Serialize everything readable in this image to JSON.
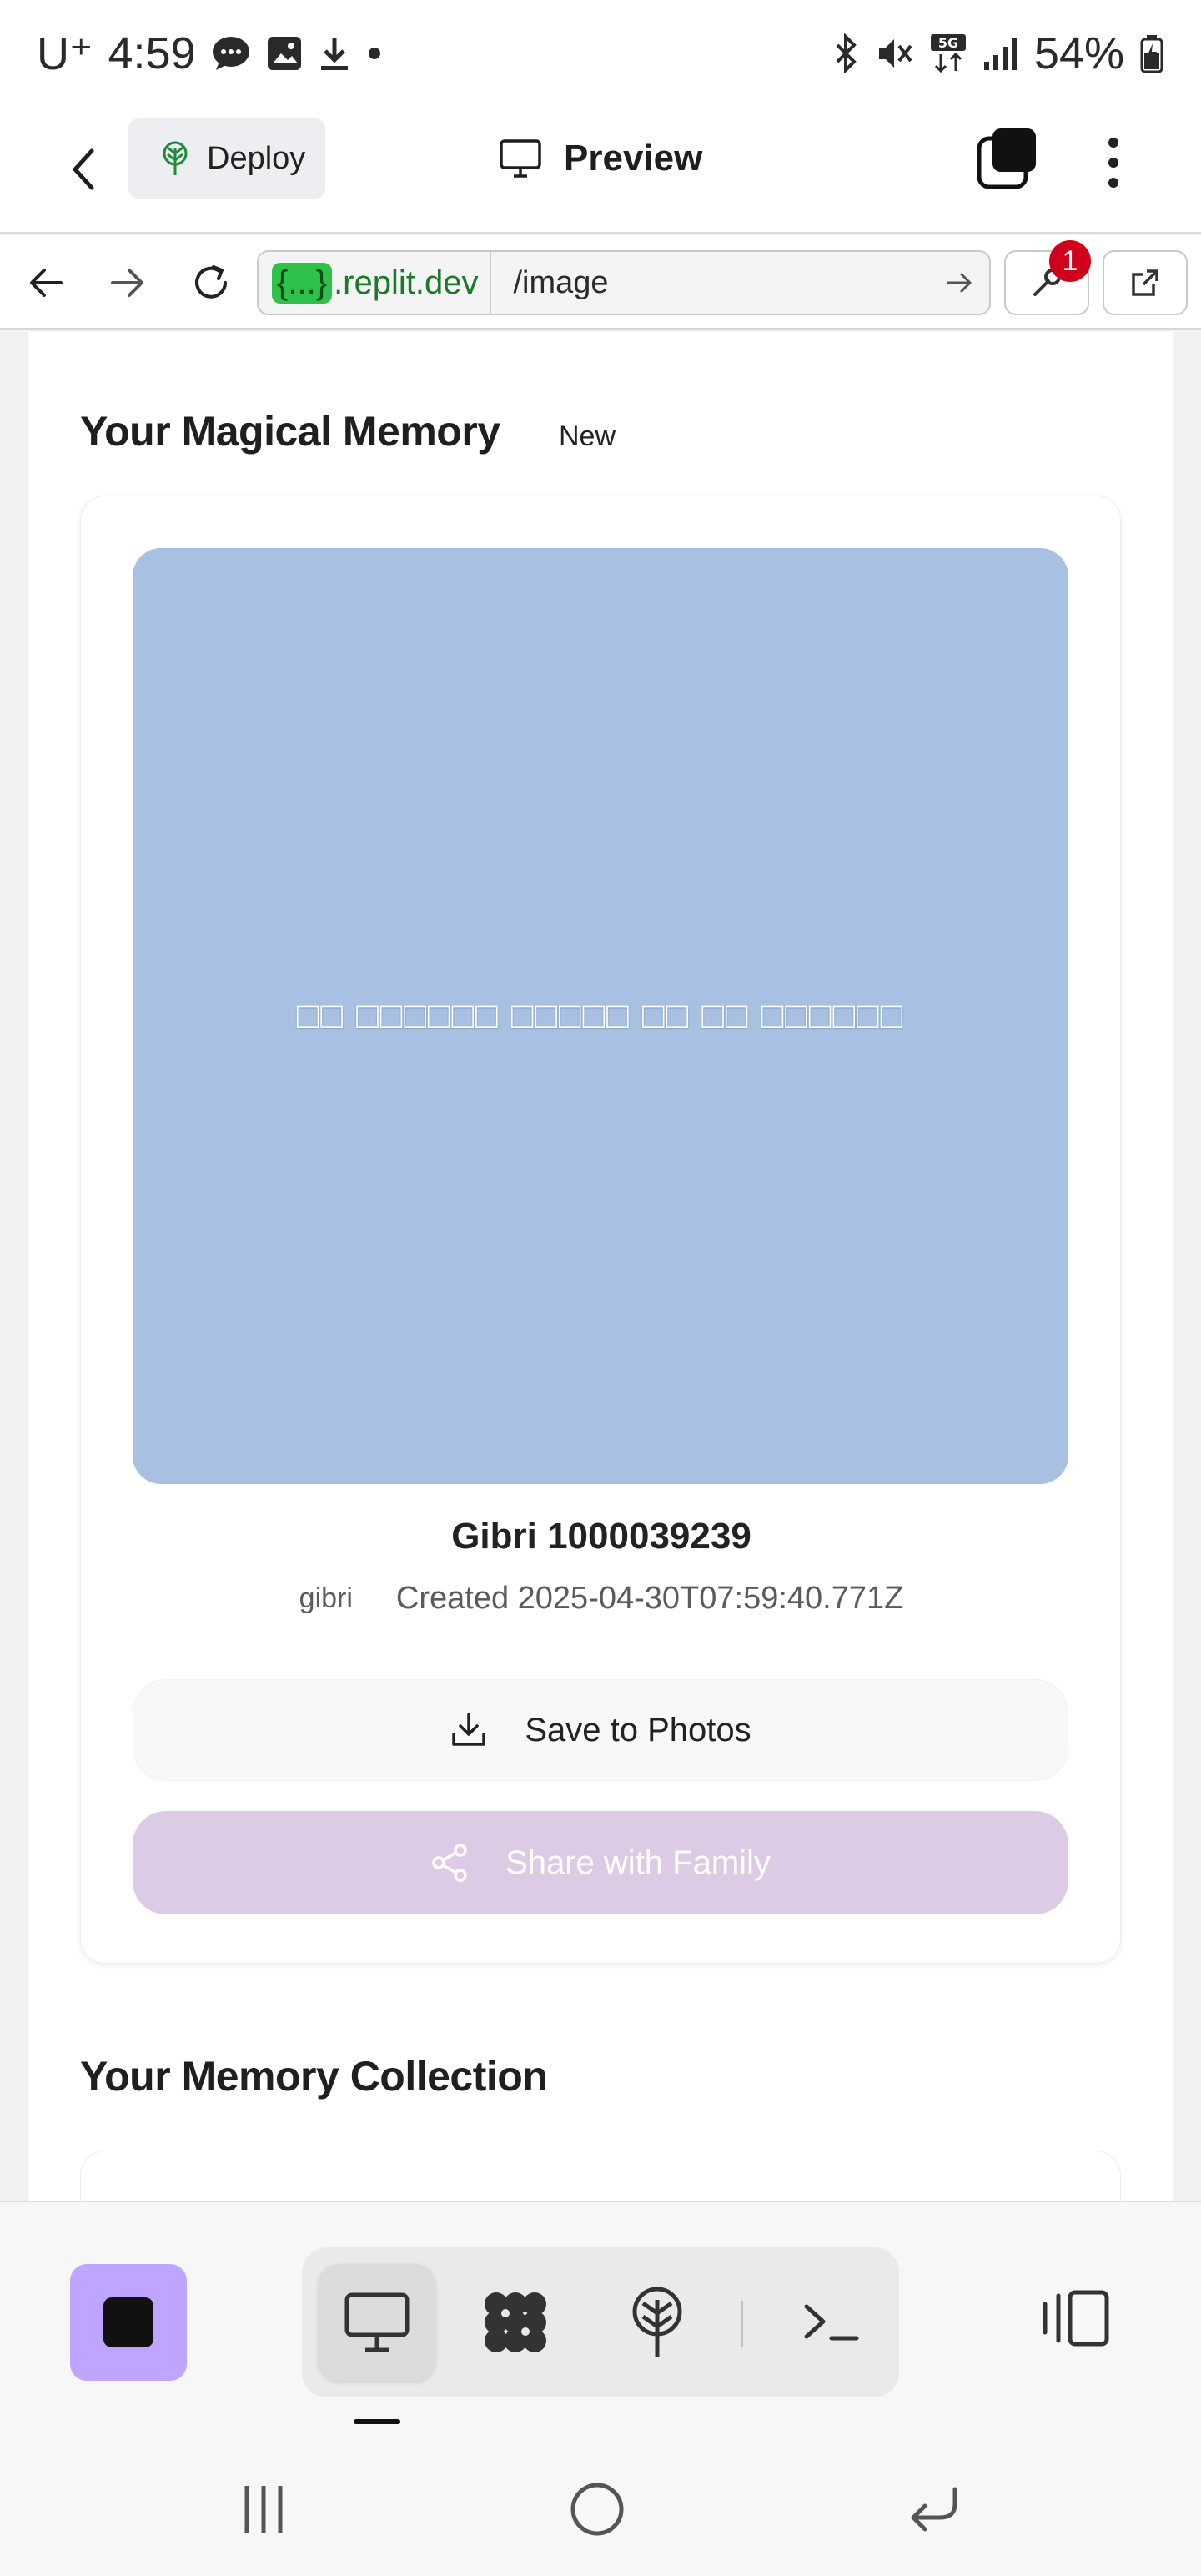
{
  "status_bar": {
    "carrier": "U⁺",
    "time": "4:59",
    "battery": "54%",
    "network": "5G",
    "left_icons": [
      "chat-bubble-icon",
      "image-icon",
      "download-icon",
      "dot-icon"
    ],
    "right_icons": [
      "bluetooth-icon",
      "mute-icon",
      "5g-icon",
      "signal-icon",
      "battery-icon"
    ]
  },
  "app_bar": {
    "deploy_label": "Deploy",
    "preview_label": "Preview"
  },
  "browser": {
    "domain_chip": "{...}",
    "domain_suffix": ".replit.dev",
    "path": "/image",
    "badge_count": "1"
  },
  "page": {
    "section_title": "Your Magical Memory",
    "new_tag": "New",
    "image_alt_text": "□□ □□□□□□ □□□□□ □□ □□ □□□□□□",
    "image_title": "Gibri 1000039239",
    "author": "gibri",
    "created": "Created 2025-04-30T07:59:40.771Z",
    "save_label": "Save to Photos",
    "share_label": "Share with Family",
    "collection_title": "Your Memory Collection"
  },
  "colors": {
    "image_bg": "#a8c1e3",
    "share_bg": "#ddcbe6",
    "stop_bg": "#bfa5ff",
    "url_chip": "#2fc14a",
    "badge": "#d0021b"
  }
}
